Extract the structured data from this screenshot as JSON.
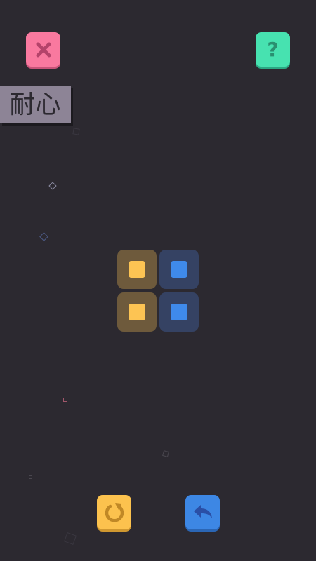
{
  "header": {
    "close_icon": "close-icon",
    "help_icon": "help-icon",
    "help_glyph": "?",
    "colors": {
      "close": "#f9799f",
      "help": "#47e2b0"
    }
  },
  "level": {
    "name": "耐心"
  },
  "board": {
    "rows": 2,
    "cols": 2,
    "tiles": [
      {
        "row": 0,
        "col": 0,
        "color": "yellow"
      },
      {
        "row": 0,
        "col": 1,
        "color": "blue"
      },
      {
        "row": 1,
        "col": 0,
        "color": "yellow"
      },
      {
        "row": 1,
        "col": 1,
        "color": "blue"
      }
    ],
    "colors": {
      "yellow": "#fdc453",
      "blue": "#3f8aeb"
    }
  },
  "footer": {
    "restart_icon": "restart-icon",
    "undo_icon": "undo-icon",
    "colors": {
      "restart": "#fcc24e",
      "undo": "#3d87e4"
    }
  },
  "background": {
    "color": "#2c2930"
  }
}
